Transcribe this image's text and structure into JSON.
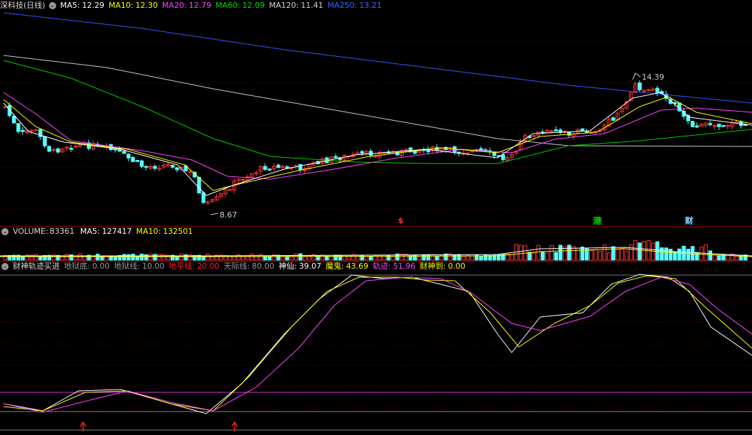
{
  "legend_main": {
    "stock": "深科技(日线)",
    "items": [
      {
        "label": "MA5:",
        "value": "12.29",
        "color": "#ffffff"
      },
      {
        "label": "MA10:",
        "value": "12.30",
        "color": "#ffff00"
      },
      {
        "label": "MA20:",
        "value": "12.79",
        "color": "#ff44ff"
      },
      {
        "label": "MA60:",
        "value": "12.09",
        "color": "#00dd00"
      },
      {
        "label": "MA120:",
        "value": "11.41",
        "color": "#d0d0d0"
      },
      {
        "label": "MA250:",
        "value": "13.21",
        "color": "#3366ff"
      }
    ]
  },
  "legend_vol": {
    "title": "VOLUME:",
    "title_value": "83361",
    "items": [
      {
        "label": "MA5:",
        "value": "127417",
        "color": "#ffffff"
      },
      {
        "label": "MA10:",
        "value": "132501",
        "color": "#ffff00"
      }
    ]
  },
  "legend_ind": {
    "title": "财神轨迹买进",
    "items": [
      {
        "label": "地狱底:",
        "value": "0.00",
        "color": "#9a9a9a"
      },
      {
        "label": "地狱线:",
        "value": "10.00",
        "color": "#9a9a9a"
      },
      {
        "label": "地平线:",
        "value": "20.00",
        "color": "#ff2222"
      },
      {
        "label": "天际线:",
        "value": "80.00",
        "color": "#9a9a9a"
      },
      {
        "label": "神仙:",
        "value": "39.07",
        "color": "#ffffff"
      },
      {
        "label": "魔鬼:",
        "value": "43.69",
        "color": "#ffff00"
      },
      {
        "label": "轨迹:",
        "value": "51.96",
        "color": "#ff44ff"
      },
      {
        "label": "财神到:",
        "value": "0.00",
        "color": "#ffff00"
      }
    ]
  },
  "annotations": {
    "high": "14.39",
    "low": "8.67"
  },
  "tags": [
    {
      "text": "$",
      "color": "#ff3333"
    },
    {
      "text": "港",
      "color": "#00cc00"
    },
    {
      "text": "财",
      "color": "#66ccff"
    }
  ],
  "colors": {
    "up": "#ff3232",
    "down": "#54ffff",
    "grid": "#7a0000"
  }
}
